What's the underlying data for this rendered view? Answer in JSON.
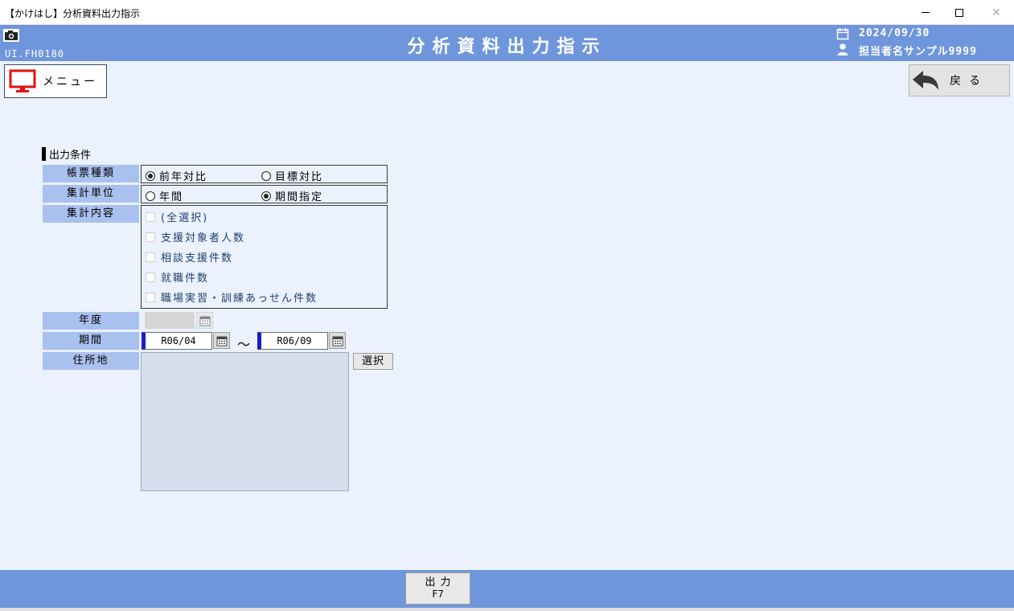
{
  "window": {
    "title": "【かけはし】分析資料出力指示",
    "minimize": "—",
    "close": "✕"
  },
  "header": {
    "screen_id": "UI.FH0180",
    "title": "分析資料出力指示",
    "date": "2024/09/30",
    "user": "担当者名サンプル9999"
  },
  "toolbar": {
    "menu_label": "メニュー",
    "back_label": "戻る"
  },
  "form": {
    "section_title": "出力条件",
    "report_type": {
      "label": "帳票種類",
      "options": [
        "前年対比",
        "目標対比"
      ],
      "selected": "前年対比"
    },
    "agg_unit": {
      "label": "集計単位",
      "options": [
        "年間",
        "期間指定"
      ],
      "selected": "期間指定"
    },
    "agg_content": {
      "label": "集計内容",
      "items": [
        "(全選択)",
        "支援対象者人数",
        "相談支援件数",
        "就職件数",
        "職場実習・訓練あっせん件数"
      ]
    },
    "fiscal_year": {
      "label": "年度",
      "value": ""
    },
    "period": {
      "label": "期間",
      "from": "R06/04",
      "separator": "～",
      "to": "R06/09"
    },
    "address": {
      "label": "住所地",
      "select_label": "選択"
    }
  },
  "footer": {
    "output_label": "出力",
    "output_key": "F7"
  },
  "colors": {
    "header_bg": "#6f96dc",
    "main_bg": "#ebf2fd",
    "label_bg": "#a9c1ee",
    "accent_border": "#1b1bd0"
  },
  "icons": [
    "camera-icon",
    "calendar-icon",
    "user-icon",
    "monitor-icon",
    "back-arrow-icon"
  ]
}
